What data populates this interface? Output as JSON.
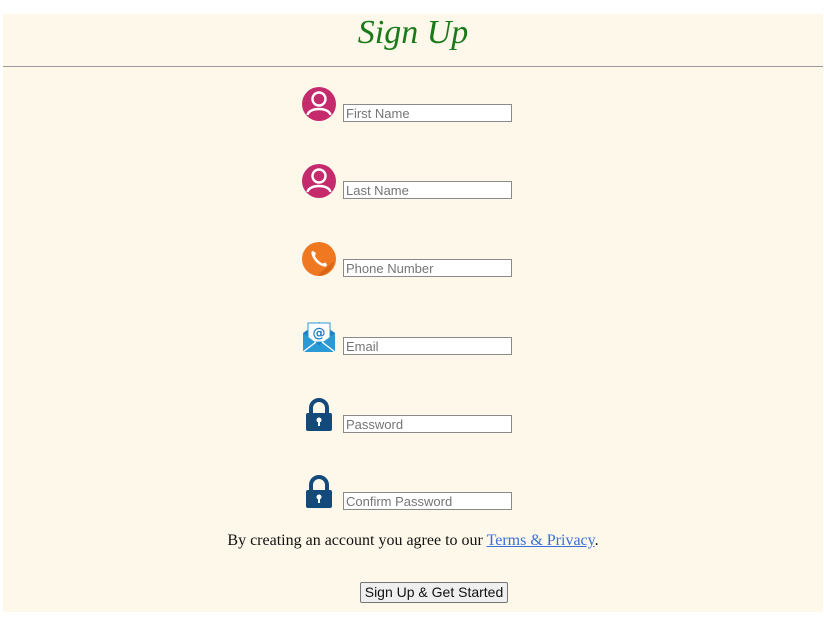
{
  "title": "Sign Up",
  "fields": [
    {
      "placeholder": "First Name",
      "icon": "user-icon",
      "type": "text"
    },
    {
      "placeholder": "Last Name",
      "icon": "user-icon",
      "type": "text"
    },
    {
      "placeholder": "Phone Number",
      "icon": "phone-icon",
      "type": "tel"
    },
    {
      "placeholder": "Email",
      "icon": "email-icon",
      "type": "email"
    },
    {
      "placeholder": "Password",
      "icon": "lock-icon",
      "type": "password"
    },
    {
      "placeholder": "Confirm Password",
      "icon": "lock-icon",
      "type": "password"
    }
  ],
  "agreement": {
    "text_before": "By creating an account you agree to our ",
    "link_label": "Terms & Privacy",
    "text_after": "."
  },
  "submit_label": "Sign Up & Get Started",
  "colors": {
    "title": "#1a7a1a",
    "page_background": "#fdf8ea",
    "user_icon": "#c42a6c",
    "phone_icon": "#f07820",
    "email_icon": "#2a9ad6",
    "lock_icon": "#144a7a",
    "link": "#3a6fd8"
  }
}
